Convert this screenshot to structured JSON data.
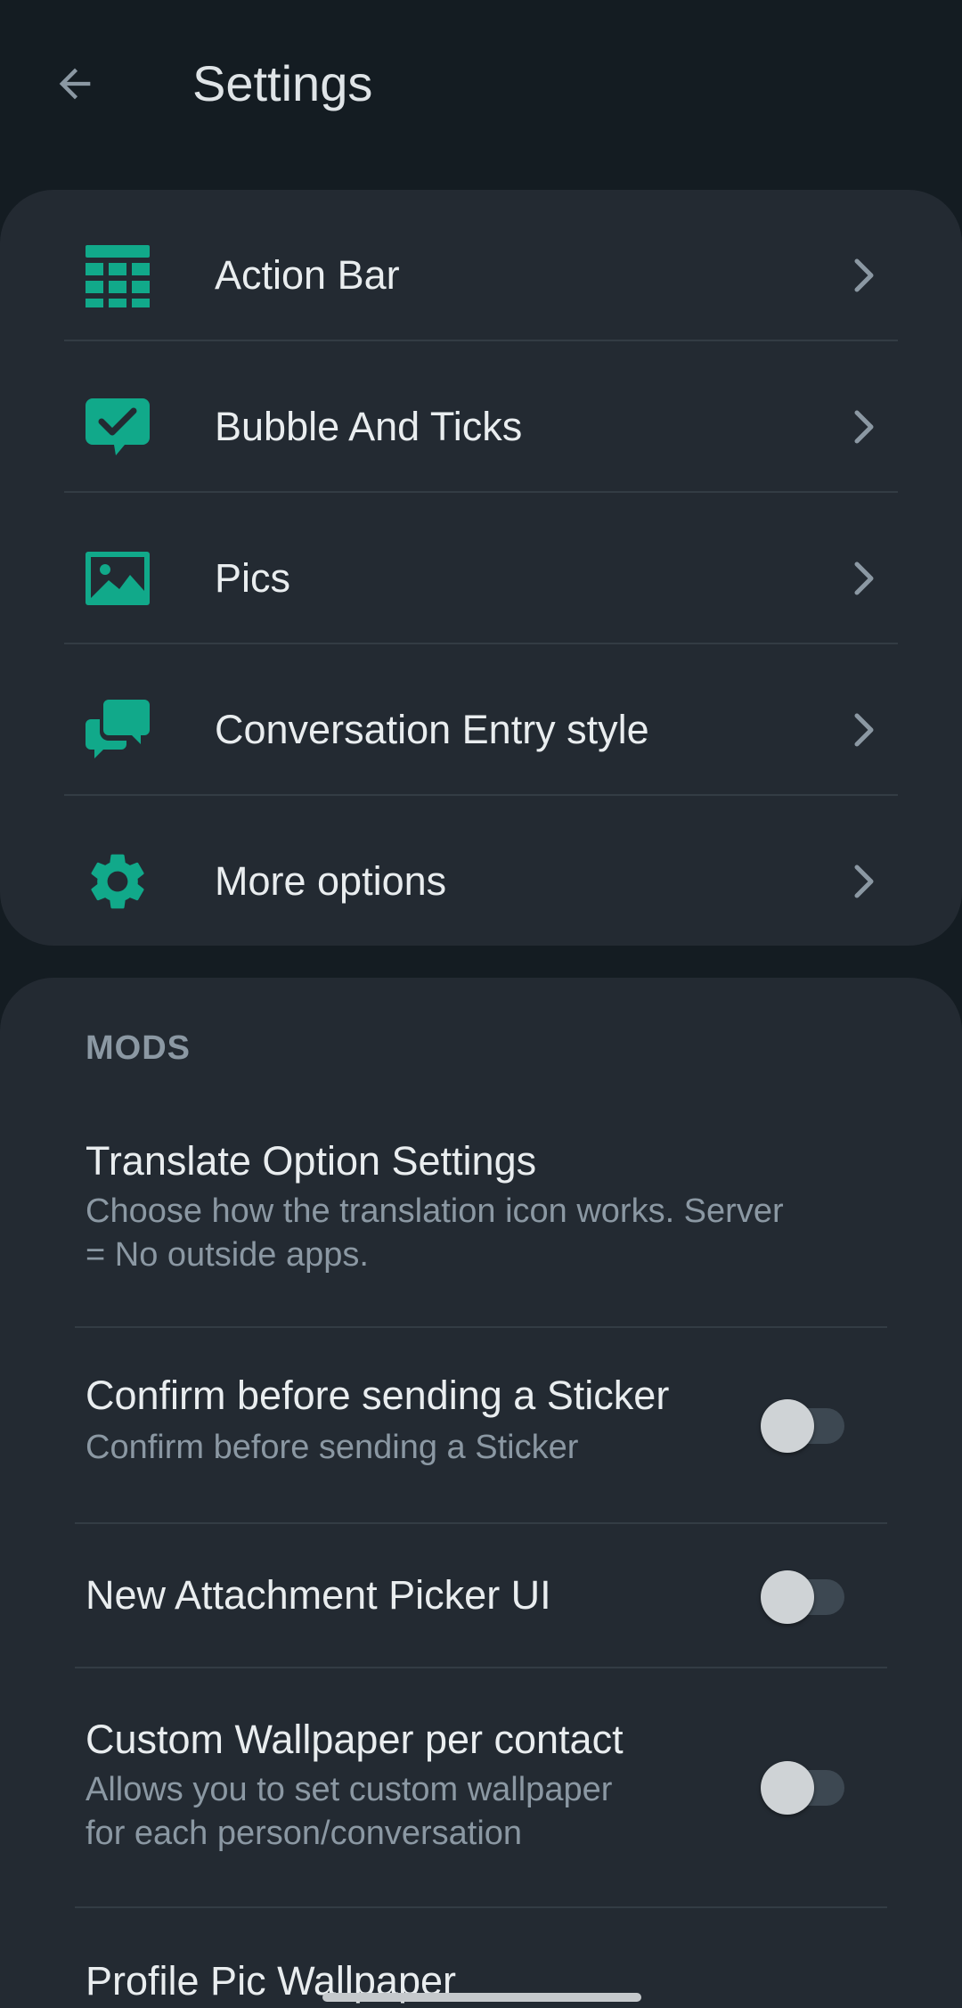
{
  "header": {
    "title": "Settings",
    "back_icon": "arrow-left-icon"
  },
  "colors": {
    "accent": "#11a98a",
    "background": "#141c22",
    "card": "#232a32",
    "text_primary": "#e9edef",
    "text_secondary": "#8b98a3"
  },
  "nav": {
    "items": [
      {
        "label": "Action Bar",
        "icon": "grid-table-icon"
      },
      {
        "label": "Bubble And Ticks",
        "icon": "chat-bubble-check-icon"
      },
      {
        "label": "Pics",
        "icon": "image-icon"
      },
      {
        "label": "Conversation Entry style",
        "icon": "conversation-bubbles-icon"
      },
      {
        "label": "More options",
        "icon": "gear-icon"
      }
    ]
  },
  "mods": {
    "section_title": "MODS",
    "items": [
      {
        "title": "Translate Option Settings",
        "summary_line1": "Choose how the translation icon works. Server",
        "summary_line2": "= No outside apps."
      },
      {
        "title": "Confirm before sending a Sticker",
        "summary_line1": "Confirm before sending a Sticker",
        "switch_on": false
      },
      {
        "title": "New Attachment Picker UI",
        "switch_on": false
      },
      {
        "title": "Custom Wallpaper per contact",
        "summary_line1": "Allows you to set custom wallpaper",
        "summary_line2": "for each person/conversation",
        "switch_on": false
      },
      {
        "title": "Profile Pic Wallpaper",
        "switch_on": false
      }
    ]
  }
}
